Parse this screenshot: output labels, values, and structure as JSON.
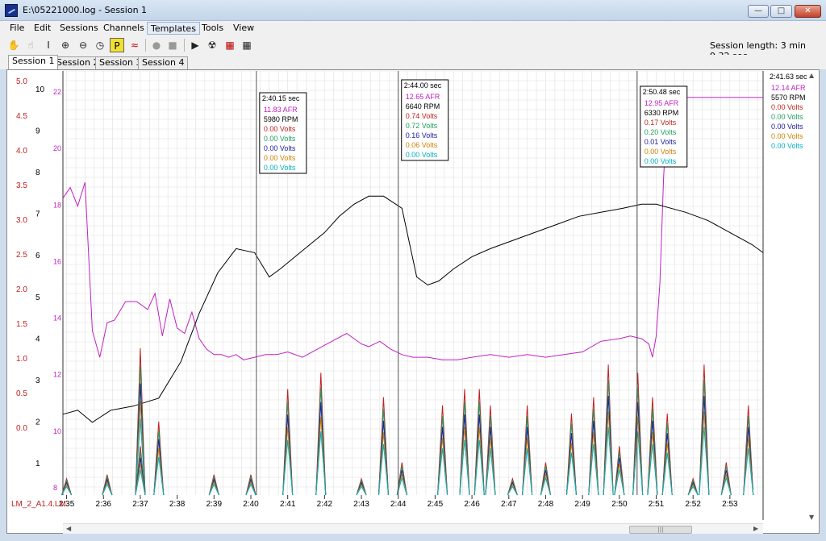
{
  "window": {
    "title": "E:\\05221000.log - Session 1"
  },
  "menu": [
    "File",
    "Edit",
    "Sessions",
    "Channels",
    "Templates",
    "Tools",
    "View"
  ],
  "toolbar": {
    "session_length_label": "Session length:",
    "session_length_value": "3 min 9.32 sec"
  },
  "tabs": [
    "Session 1",
    "Session 2",
    "Session 3",
    "Session 4"
  ],
  "colors": {
    "afr": "#c020c0",
    "rpm": "#000000",
    "v1": "#c02020",
    "v2": "#20a060",
    "v3": "#2020a0",
    "v4": "#d08000",
    "v5": "#00b0c0",
    "grid": "#e0e0e0"
  },
  "axes": {
    "left_voltage_ticks": [
      "5.0",
      "4.5",
      "4.0",
      "3.5",
      "3.0",
      "2.5",
      "2.0",
      "1.5",
      "1.0",
      "0.5",
      "0.0"
    ],
    "left_rpm_ticks": [
      "10",
      "9",
      "8",
      "7",
      "6",
      "5",
      "4",
      "3",
      "2",
      "1"
    ],
    "left_afr_ticks": [
      "22",
      "20",
      "18",
      "16",
      "14",
      "12",
      "10",
      "8"
    ],
    "channel_label": "LM_2_A1.4.LM"
  },
  "chart_data": {
    "type": "line",
    "x_unit": "m:ss",
    "x_ticks": [
      "2:35",
      "2:36",
      "2:37",
      "2:38",
      "2:39",
      "2:40",
      "2:41",
      "2:42",
      "2:43",
      "2:44",
      "2:45",
      "2:46",
      "2:47",
      "2:48",
      "2:49",
      "2:50",
      "2:51",
      "2:52",
      "2:53"
    ],
    "xlim": [
      154.9,
      173.9
    ],
    "series": [
      {
        "key": "afr",
        "unit": "AFR",
        "ylim": [
          7,
          23
        ],
        "x": [
          154.9,
          155.1,
          155.3,
          155.5,
          155.7,
          155.9,
          156.1,
          156.3,
          156.6,
          156.9,
          157.2,
          157.4,
          157.6,
          157.8,
          158.0,
          158.2,
          158.4,
          158.6,
          158.8,
          159.0,
          159.2,
          159.4,
          159.6,
          159.8,
          160.1,
          160.4,
          160.7,
          161.0,
          161.4,
          161.8,
          162.2,
          162.6,
          162.8,
          163.0,
          163.2,
          163.5,
          163.8,
          164.1,
          164.4,
          164.8,
          165.2,
          165.6,
          166.0,
          166.5,
          167.0,
          167.5,
          168.0,
          168.5,
          169.0,
          169.5,
          170.0,
          170.3,
          170.6,
          170.8,
          170.9,
          171.0,
          171.1,
          171.2,
          171.3,
          171.5,
          172.0,
          173.9
        ],
        "y": [
          18.2,
          18.6,
          17.9,
          18.8,
          13.2,
          12.2,
          13.5,
          13.6,
          14.3,
          14.3,
          14.0,
          14.6,
          13.0,
          14.4,
          13.3,
          13.1,
          13.9,
          12.9,
          12.5,
          12.3,
          12.3,
          12.2,
          12.3,
          12.1,
          12.2,
          12.3,
          12.3,
          12.4,
          12.2,
          12.5,
          12.8,
          13.1,
          12.9,
          12.7,
          12.6,
          12.8,
          12.5,
          12.3,
          12.2,
          12.2,
          12.1,
          12.1,
          12.2,
          12.3,
          12.2,
          12.3,
          12.2,
          12.3,
          12.4,
          12.8,
          12.9,
          13.0,
          12.9,
          12.7,
          12.2,
          13.0,
          15.0,
          19.0,
          21.5,
          22.0,
          22.0,
          22.0
        ]
      },
      {
        "key": "rpm",
        "unit": "RPM",
        "ylim": [
          0,
          10.5
        ],
        "x": [
          154.9,
          155.3,
          155.7,
          156.2,
          156.8,
          157.5,
          158.1,
          158.6,
          159.1,
          159.6,
          160.1,
          160.5,
          160.8,
          161.2,
          161.6,
          162.0,
          162.4,
          162.8,
          163.2,
          163.6,
          164.1,
          164.5,
          164.8,
          165.1,
          165.5,
          166.0,
          166.5,
          167.1,
          167.7,
          168.3,
          168.9,
          169.5,
          170.1,
          170.6,
          171.0,
          171.4,
          171.8,
          172.4,
          173.0,
          173.6,
          173.9
        ],
        "y": [
          2.0,
          2.1,
          1.8,
          2.1,
          2.2,
          2.4,
          3.3,
          4.5,
          5.5,
          6.1,
          6.0,
          5.4,
          5.6,
          5.9,
          6.2,
          6.5,
          6.9,
          7.2,
          7.4,
          7.4,
          7.1,
          5.4,
          5.2,
          5.3,
          5.6,
          5.9,
          6.1,
          6.3,
          6.5,
          6.7,
          6.9,
          7.0,
          7.1,
          7.2,
          7.2,
          7.1,
          7.0,
          6.8,
          6.5,
          6.2,
          6.0
        ]
      }
    ],
    "volt_channels": [
      "v1",
      "v2",
      "v3",
      "v4",
      "v5"
    ],
    "volt_ylim": [
      0,
      5.2
    ],
    "volt_spike_times": [
      155.0,
      156.1,
      157.0,
      157.0,
      157.5,
      159.0,
      160.0,
      161.0,
      161.9,
      163.0,
      163.6,
      164.1,
      165.2,
      165.8,
      166.2,
      166.5,
      167.1,
      167.5,
      168.0,
      168.7,
      169.3,
      169.7,
      170.0,
      170.5,
      170.9,
      171.3,
      172.0,
      172.3,
      172.9,
      173.5
    ],
    "volt_spike_peaks": [
      0.2,
      0.25,
      1.8,
      0.6,
      0.9,
      0.25,
      0.25,
      1.3,
      1.5,
      0.2,
      1.2,
      0.4,
      1.1,
      1.3,
      1.3,
      1.1,
      0.2,
      1.1,
      0.4,
      1.0,
      1.2,
      1.6,
      0.6,
      1.5,
      1.2,
      1.0,
      0.2,
      1.6,
      0.4,
      1.1
    ],
    "cursors": [
      {
        "time": "2:40.15 sec",
        "x": 160.15,
        "afr": "11.83 AFR",
        "rpm": "5980 RPM",
        "v1": "0.00 Volts",
        "v2": "0.00 Volts",
        "v3": "0.00 Volts",
        "v4": "0.00 Volts",
        "v5": "0.00 Volts"
      },
      {
        "time": "2:44.00 sec",
        "x": 164.0,
        "afr": "12.65 AFR",
        "rpm": "6640 RPM",
        "v1": "0.74 Volts",
        "v2": "0.72 Volts",
        "v3": "0.16 Volts",
        "v4": "0.06 Volts",
        "v5": "0.00 Volts"
      },
      {
        "time": "2:50.48 sec",
        "x": 170.48,
        "afr": "12.95 AFR",
        "rpm": "6330 RPM",
        "v1": "0.17 Volts",
        "v2": "0.20 Volts",
        "v3": "0.01 Volts",
        "v4": "0.00 Volts",
        "v5": "0.00 Volts"
      }
    ],
    "right_readout": {
      "time": "2:41.63 sec",
      "afr": "12.14 AFR",
      "rpm": "5570 RPM",
      "v1": "0.00 Volts",
      "v2": "0.00 Volts",
      "v3": "0.00 Volts",
      "v4": "0.00 Volts",
      "v5": "0.00 Volts"
    }
  }
}
